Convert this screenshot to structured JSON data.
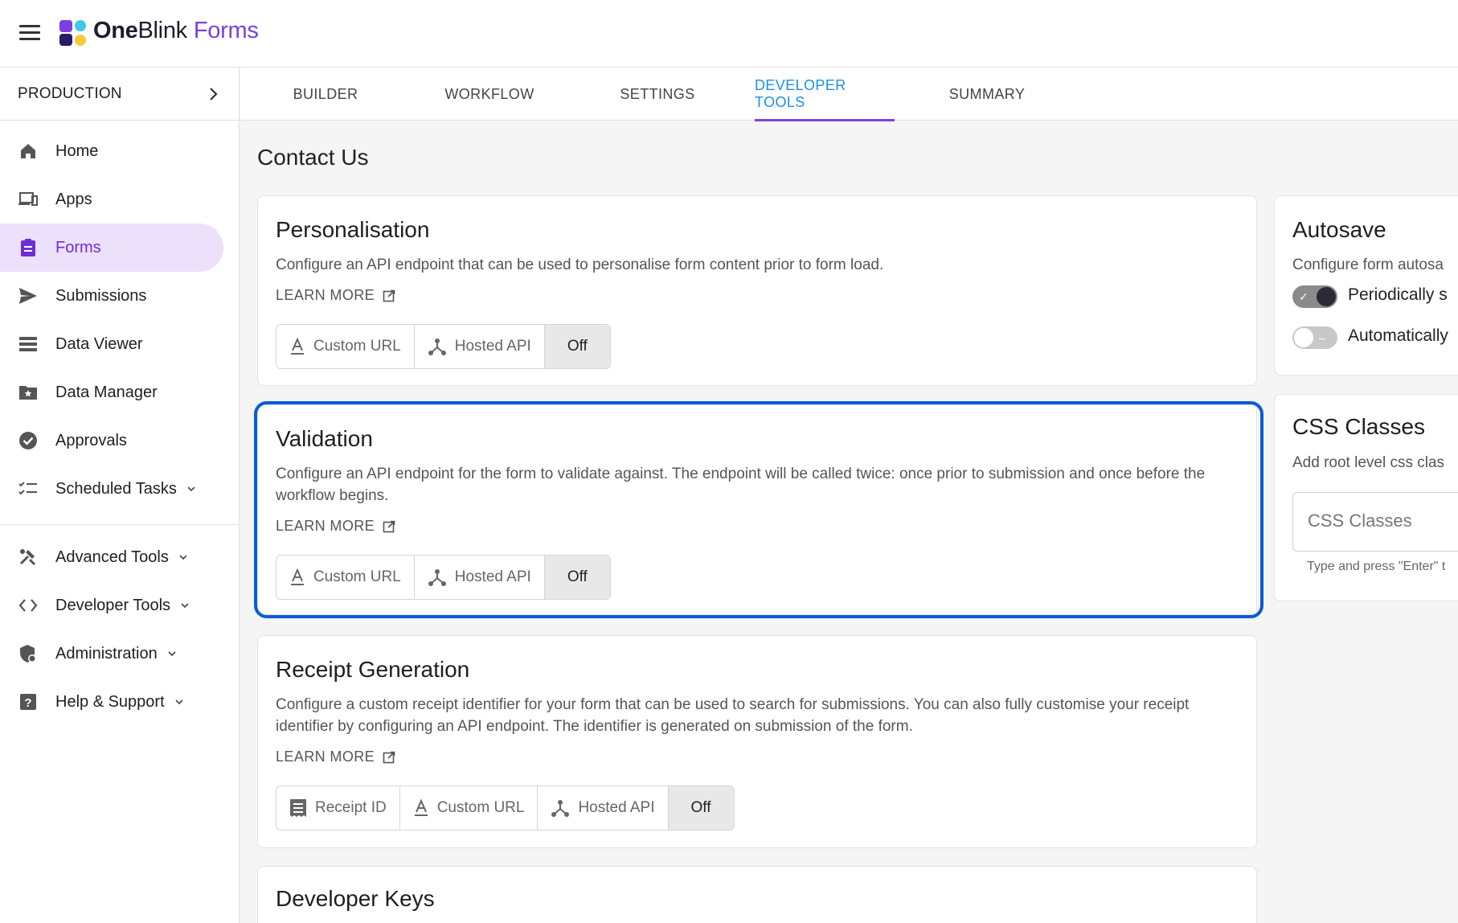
{
  "app": {
    "brand_one": "One",
    "brand_blink": "Blink",
    "brand_forms": "Forms"
  },
  "sidebar": {
    "environment": "PRODUCTION",
    "items": [
      {
        "label": "Home",
        "icon": "home-icon"
      },
      {
        "label": "Apps",
        "icon": "devices-icon"
      },
      {
        "label": "Forms",
        "icon": "clipboard-icon",
        "active": true
      },
      {
        "label": "Submissions",
        "icon": "send-icon"
      },
      {
        "label": "Data Viewer",
        "icon": "table-rows-icon"
      },
      {
        "label": "Data Manager",
        "icon": "folder-star-icon"
      },
      {
        "label": "Approvals",
        "icon": "check-circle-icon"
      },
      {
        "label": "Scheduled Tasks",
        "icon": "checklist-icon"
      }
    ],
    "secondary": [
      {
        "label": "Advanced Tools",
        "icon": "tools-icon"
      },
      {
        "label": "Developer Tools",
        "icon": "code-icon"
      },
      {
        "label": "Administration",
        "icon": "admin-shield-icon"
      },
      {
        "label": "Help & Support",
        "icon": "help-icon"
      }
    ]
  },
  "tabs": [
    {
      "label": "BUILDER"
    },
    {
      "label": "WORKFLOW"
    },
    {
      "label": "SETTINGS"
    },
    {
      "label": "DEVELOPER TOOLS",
      "active": true
    },
    {
      "label": "SUMMARY"
    }
  ],
  "page": {
    "title": "Contact Us"
  },
  "personalisation": {
    "title": "Personalisation",
    "description": "Configure an API endpoint that can be used to personalise form content prior to form load.",
    "learn_more": "LEARN MORE",
    "options": [
      "Custom URL",
      "Hosted API",
      "Off"
    ],
    "selected": "Off"
  },
  "validation": {
    "title": "Validation",
    "description": "Configure an API endpoint for the form to validate against. The endpoint will be called twice: once prior to submission and once before the workflow begins.",
    "learn_more": "LEARN MORE",
    "options": [
      "Custom URL",
      "Hosted API",
      "Off"
    ],
    "selected": "Off"
  },
  "receipt": {
    "title": "Receipt Generation",
    "description": "Configure a custom receipt identifier for your form that can be used to search for submissions. You can also fully customise your receipt identifier by configuring an API endpoint. The identifier is generated on submission of the form.",
    "learn_more": "LEARN MORE",
    "options": [
      "Receipt ID",
      "Custom URL",
      "Hosted API",
      "Off"
    ],
    "selected": "Off"
  },
  "developer_keys": {
    "title": "Developer Keys"
  },
  "autosave": {
    "title": "Autosave",
    "description": "Configure form autosa",
    "switch1_label": "Periodically s",
    "switch1_on": true,
    "switch2_label": "Automatically",
    "switch2_on": false
  },
  "css_classes": {
    "title": "CSS Classes",
    "description": "Add root level css clas",
    "placeholder": "CSS Classes",
    "hint": "Type and press \"Enter\" t"
  }
}
